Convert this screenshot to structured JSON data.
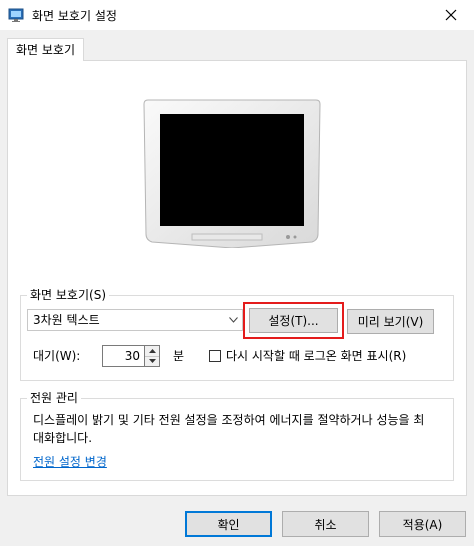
{
  "window": {
    "title": "화면 보호기 설정",
    "app_icon": "screen-saver-icon",
    "close_icon": "close-icon"
  },
  "tab": {
    "label": "화면 보호기"
  },
  "screensaver": {
    "group_label": "화면 보호기(S)",
    "selected": "3차원 텍스트",
    "settings_button": "설정(T)...",
    "preview_button": "미리 보기(V)",
    "wait_label": "대기(W):",
    "wait_value": "30",
    "wait_unit": "분",
    "resume_logon_label": "다시 시작할 때 로그온 화면 표시(R)",
    "resume_logon_checked": false
  },
  "power": {
    "group_label": "전원 관리",
    "description": "디스플레이 밝기 및 기타 전원 설정을 조정하여 에너지를 절약하거나 성능을 최대화합니다.",
    "link": "전원 설정 변경"
  },
  "buttons": {
    "ok": "확인",
    "cancel": "취소",
    "apply": "적용(A)"
  },
  "colors": {
    "highlight": "#e41c1c",
    "link": "#0066cc",
    "focus": "#0078d7"
  }
}
